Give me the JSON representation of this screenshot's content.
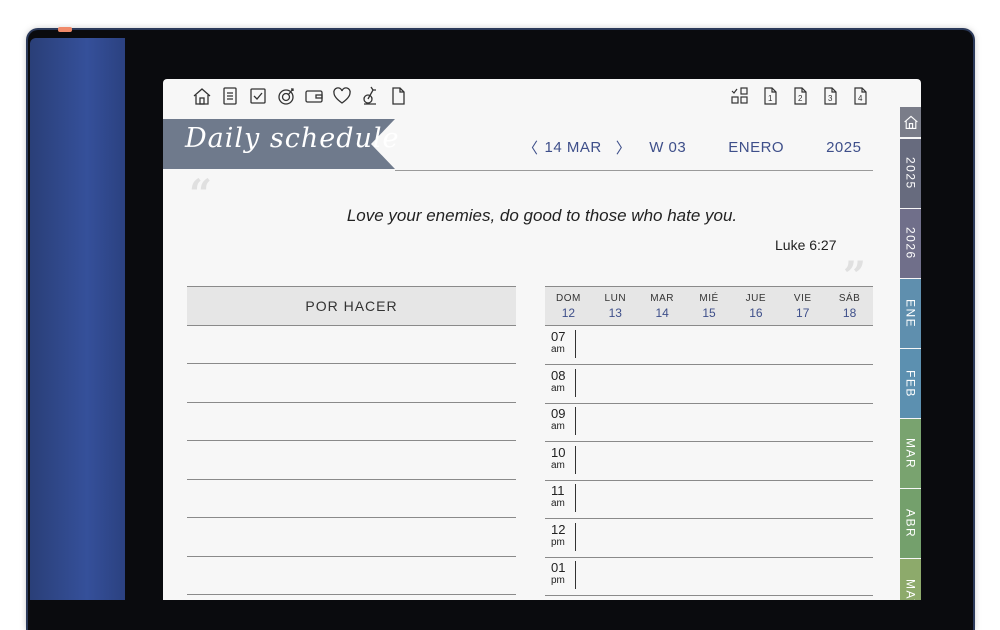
{
  "toolbar": {
    "left_icons": [
      "home-icon",
      "notes-icon",
      "checkbox-icon",
      "goal-icon",
      "wallet-icon",
      "heart-icon",
      "fitness-icon",
      "page-icon"
    ],
    "right_icons": [
      "layout-icon",
      "page-1-icon",
      "page-2-icon",
      "page-3-icon",
      "page-4-icon"
    ],
    "page_icon_labels": [
      "1",
      "2",
      "3",
      "4"
    ]
  },
  "header": {
    "title": "Daily schedule",
    "prev_arrow": "〈",
    "date": "14 MAR",
    "next_arrow": "〉",
    "week": "W 03",
    "month": "ENERO",
    "year": "2025"
  },
  "quote": {
    "open_mark": "“",
    "close_mark": "”",
    "text": "Love your enemies, do good to those who hate you.",
    "reference": "Luke 6:27"
  },
  "todo": {
    "header": "POR HACER"
  },
  "week": [
    {
      "day": "DOM",
      "num": "12"
    },
    {
      "day": "LUN",
      "num": "13"
    },
    {
      "day": "MAR",
      "num": "14"
    },
    {
      "day": "MIÉ",
      "num": "15"
    },
    {
      "day": "JUE",
      "num": "16"
    },
    {
      "day": "VIE",
      "num": "17"
    },
    {
      "day": "SÁB",
      "num": "18"
    }
  ],
  "hours": [
    {
      "h": "07",
      "p": "am"
    },
    {
      "h": "08",
      "p": "am"
    },
    {
      "h": "09",
      "p": "am"
    },
    {
      "h": "10",
      "p": "am"
    },
    {
      "h": "11",
      "p": "am"
    },
    {
      "h": "12",
      "p": "pm"
    },
    {
      "h": "01",
      "p": "pm"
    }
  ],
  "side_tabs": [
    {
      "label": "2025",
      "color": "#676b7e"
    },
    {
      "label": "2026",
      "color": "#706f8a"
    },
    {
      "label": "ENE",
      "color": "#5f8fae"
    },
    {
      "label": "FEB",
      "color": "#5c90b0"
    },
    {
      "label": "MAR",
      "color": "#79a36f"
    },
    {
      "label": "ABR",
      "color": "#74a06c"
    },
    {
      "label": "MAY",
      "color": "#8daa6b"
    }
  ],
  "colors": {
    "banner": "#6f7a8c",
    "accent": "#3e4f8a",
    "home_tab": "#7a7d89"
  }
}
